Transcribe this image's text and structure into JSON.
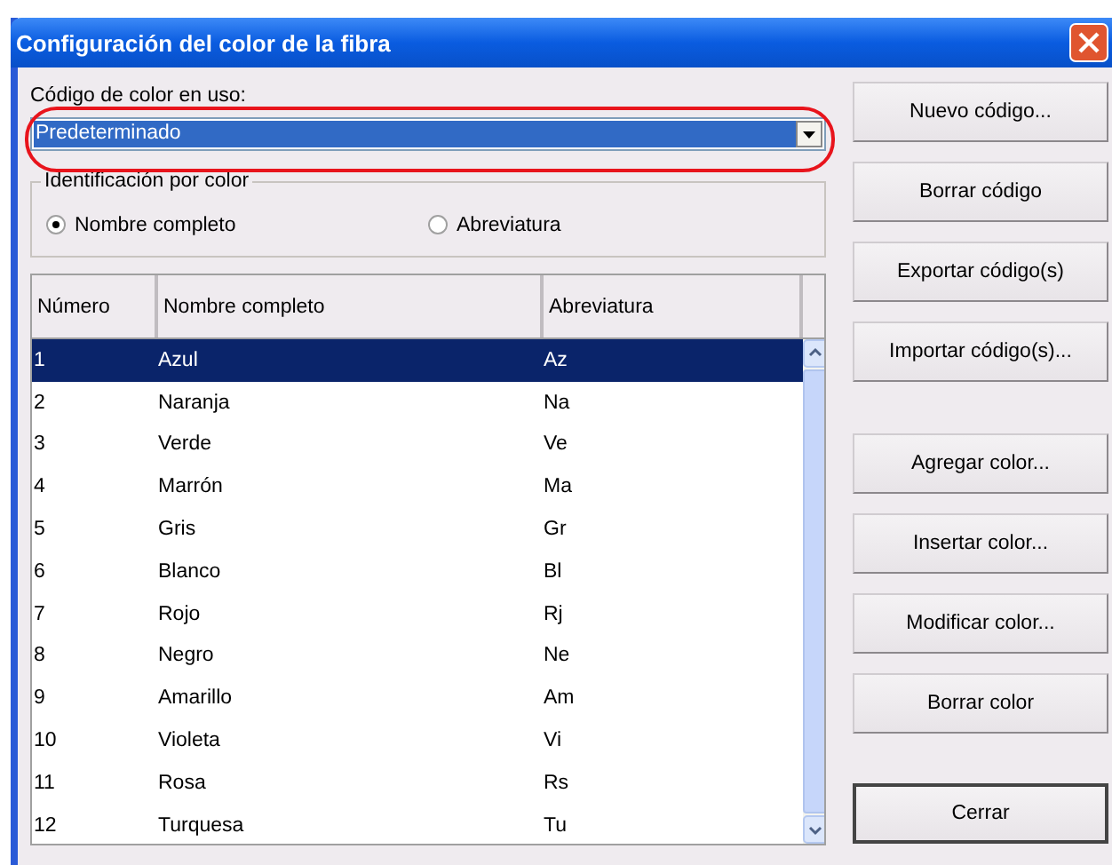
{
  "window": {
    "title": "Configuración del color de la fibra"
  },
  "code_in_use": {
    "label": "Código de color en uso:",
    "value": "Predeterminado"
  },
  "identification": {
    "label": "Identificación por color",
    "options": [
      {
        "label": "Nombre completo",
        "selected": true
      },
      {
        "label": "Abreviatura",
        "selected": false
      }
    ]
  },
  "table": {
    "columns": [
      "Número",
      "Nombre completo",
      "Abreviatura"
    ],
    "rows": [
      {
        "cells": [
          "1",
          "Azul",
          "Az"
        ],
        "selected": true
      },
      {
        "cells": [
          "2",
          "Naranja",
          "Na"
        ],
        "selected": false
      },
      {
        "cells": [
          "3",
          "Verde",
          "Ve"
        ],
        "selected": false
      },
      {
        "cells": [
          "4",
          "Marrón",
          "Ma"
        ],
        "selected": false
      },
      {
        "cells": [
          "5",
          "Gris",
          "Gr"
        ],
        "selected": false
      },
      {
        "cells": [
          "6",
          "Blanco",
          "Bl"
        ],
        "selected": false
      },
      {
        "cells": [
          "7",
          "Rojo",
          "Rj"
        ],
        "selected": false
      },
      {
        "cells": [
          "8",
          "Negro",
          "Ne"
        ],
        "selected": false
      },
      {
        "cells": [
          "9",
          "Amarillo",
          "Am"
        ],
        "selected": false
      },
      {
        "cells": [
          "10",
          "Violeta",
          "Vi"
        ],
        "selected": false
      },
      {
        "cells": [
          "11",
          "Rosa",
          "Rs"
        ],
        "selected": false
      },
      {
        "cells": [
          "12",
          "Turquesa",
          "Tu"
        ],
        "selected": false
      }
    ]
  },
  "button_groups": [
    {
      "buttons": [
        {
          "label": "Nuevo código...",
          "default": false
        },
        {
          "label": "Borrar código",
          "default": false
        },
        {
          "label": "Exportar código(s)",
          "default": false
        },
        {
          "label": "Importar código(s)...",
          "default": false
        }
      ]
    },
    {
      "buttons": [
        {
          "label": "Agregar color...",
          "default": false
        },
        {
          "label": "Insertar color...",
          "default": false
        },
        {
          "label": "Modificar color...",
          "default": false
        },
        {
          "label": "Borrar color",
          "default": false
        }
      ]
    },
    {
      "buttons": [
        {
          "label": "Cerrar",
          "default": true
        }
      ]
    }
  ]
}
